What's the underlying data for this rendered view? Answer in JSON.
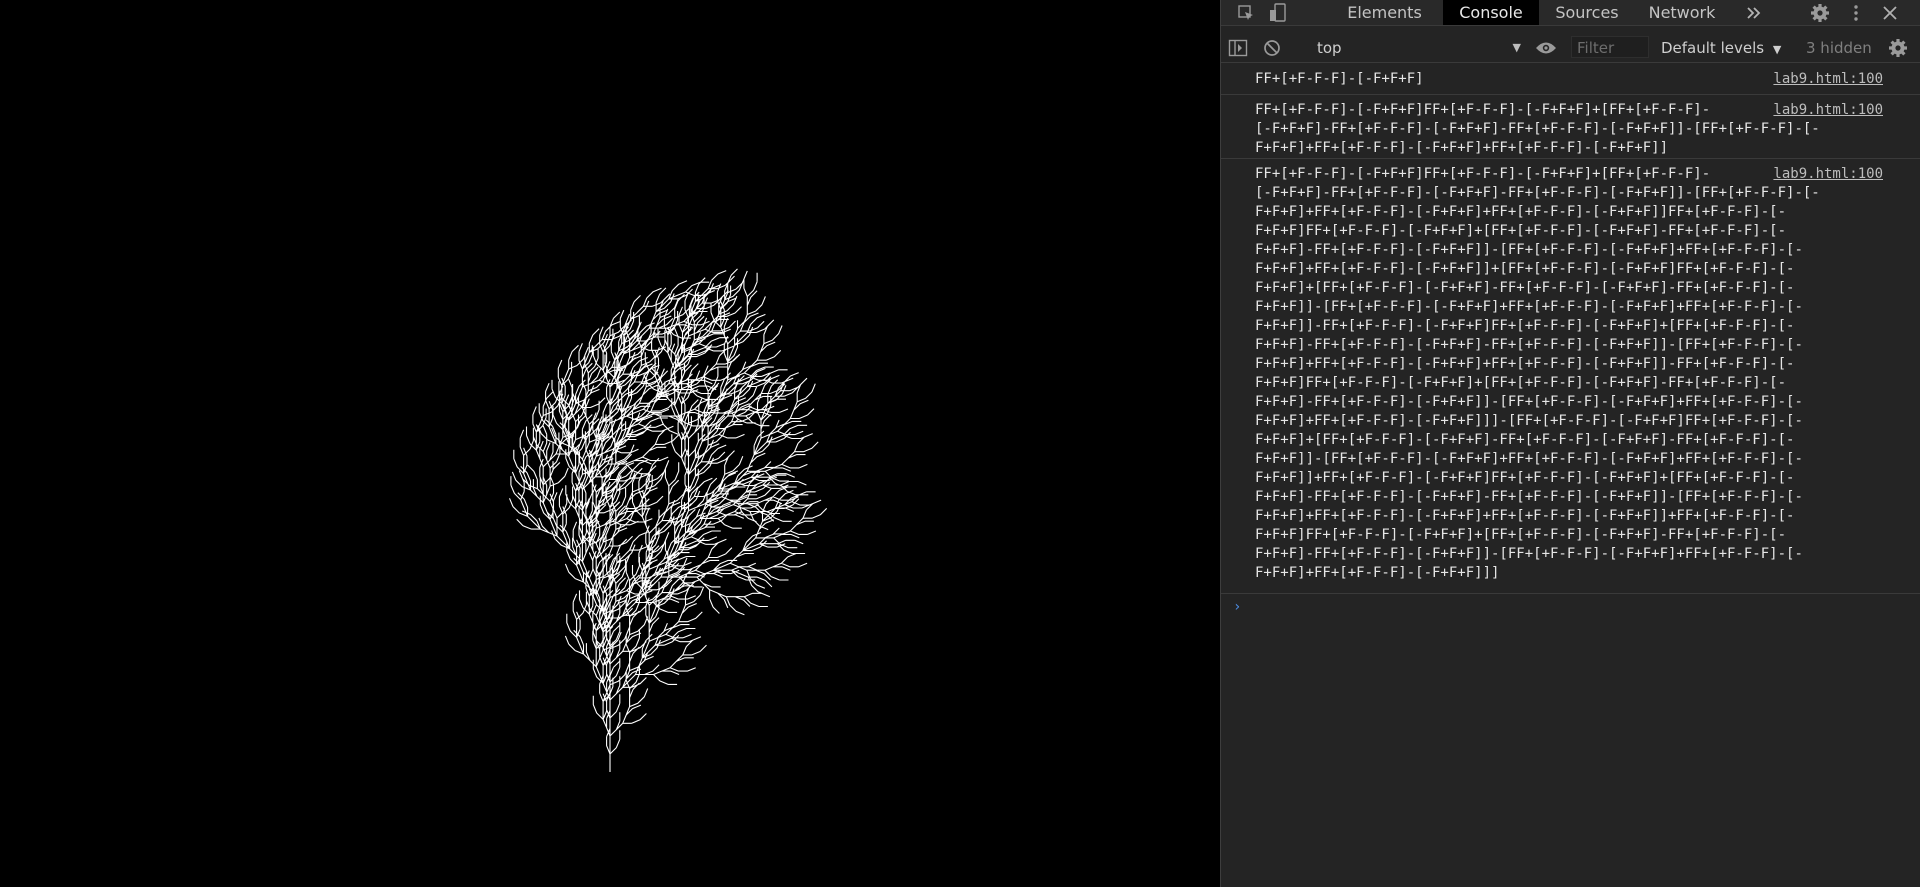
{
  "devtools": {
    "tabs": [
      {
        "label": "Elements"
      },
      {
        "label": "Console"
      },
      {
        "label": "Sources"
      },
      {
        "label": "Network"
      }
    ],
    "more_tabs_icon": "double-chevron-right-icon",
    "icons": {
      "inspect": "inspect-element-icon",
      "device": "device-toggle-icon",
      "settings": "gear-icon",
      "menu": "kebab-menu-icon",
      "close": "close-icon"
    }
  },
  "console": {
    "context": "top",
    "filter_placeholder": "Filter",
    "levels_label": "Default levels",
    "hidden_count": "3 hidden",
    "messages": [
      {
        "source": "lab9.html:100",
        "lines": [
          "FF+[+F-F-F]-[-F+F+F]"
        ]
      },
      {
        "source": "lab9.html:100",
        "lines": [
          "FF+[+F-F-F]-[-F+F+F]FF+[+F-F-F]-[-F+F+F]+[FF+[+F-F-F]-",
          "[-F+F+F]-FF+[+F-F-F]-[-F+F+F]-FF+[+F-F-F]-[-F+F+F]]-[FF+[+F-F-F]-[-",
          "F+F+F]+FF+[+F-F-F]-[-F+F+F]+FF+[+F-F-F]-[-F+F+F]]"
        ]
      },
      {
        "source": "lab9.html:100",
        "lines": [
          "FF+[+F-F-F]-[-F+F+F]FF+[+F-F-F]-[-F+F+F]+[FF+[+F-F-F]-",
          "[-F+F+F]-FF+[+F-F-F]-[-F+F+F]-FF+[+F-F-F]-[-F+F+F]]-[FF+[+F-F-F]-[-",
          "F+F+F]+FF+[+F-F-F]-[-F+F+F]+FF+[+F-F-F]-[-F+F+F]]FF+[+F-F-F]-[-",
          "F+F+F]FF+[+F-F-F]-[-F+F+F]+[FF+[+F-F-F]-[-F+F+F]-FF+[+F-F-F]-[-",
          "F+F+F]-FF+[+F-F-F]-[-F+F+F]]-[FF+[+F-F-F]-[-F+F+F]+FF+[+F-F-F]-[-",
          "F+F+F]+FF+[+F-F-F]-[-F+F+F]]+[FF+[+F-F-F]-[-F+F+F]FF+[+F-F-F]-[-",
          "F+F+F]+[FF+[+F-F-F]-[-F+F+F]-FF+[+F-F-F]-[-F+F+F]-FF+[+F-F-F]-[-",
          "F+F+F]]-[FF+[+F-F-F]-[-F+F+F]+FF+[+F-F-F]-[-F+F+F]+FF+[+F-F-F]-[-",
          "F+F+F]]-FF+[+F-F-F]-[-F+F+F]FF+[+F-F-F]-[-F+F+F]+[FF+[+F-F-F]-[-",
          "F+F+F]-FF+[+F-F-F]-[-F+F+F]-FF+[+F-F-F]-[-F+F+F]]-[FF+[+F-F-F]-[-",
          "F+F+F]+FF+[+F-F-F]-[-F+F+F]+FF+[+F-F-F]-[-F+F+F]]-FF+[+F-F-F]-[-",
          "F+F+F]FF+[+F-F-F]-[-F+F+F]+[FF+[+F-F-F]-[-F+F+F]-FF+[+F-F-F]-[-",
          "F+F+F]-FF+[+F-F-F]-[-F+F+F]]-[FF+[+F-F-F]-[-F+F+F]+FF+[+F-F-F]-[-",
          "F+F+F]+FF+[+F-F-F]-[-F+F+F]]]-[FF+[+F-F-F]-[-F+F+F]FF+[+F-F-F]-[-",
          "F+F+F]+[FF+[+F-F-F]-[-F+F+F]-FF+[+F-F-F]-[-F+F+F]-FF+[+F-F-F]-[-",
          "F+F+F]]-[FF+[+F-F-F]-[-F+F+F]+FF+[+F-F-F]-[-F+F+F]+FF+[+F-F-F]-[-",
          "F+F+F]]+FF+[+F-F-F]-[-F+F+F]FF+[+F-F-F]-[-F+F+F]+[FF+[+F-F-F]-[-",
          "F+F+F]-FF+[+F-F-F]-[-F+F+F]-FF+[+F-F-F]-[-F+F+F]]-[FF+[+F-F-F]-[-",
          "F+F+F]+FF+[+F-F-F]-[-F+F+F]+FF+[+F-F-F]-[-F+F+F]]+FF+[+F-F-F]-[-",
          "F+F+F]FF+[+F-F-F]-[-F+F+F]+[FF+[+F-F-F]-[-F+F+F]-FF+[+F-F-F]-[-",
          "F+F+F]-FF+[+F-F-F]-[-F+F+F]]-[FF+[+F-F-F]-[-F+F+F]+FF+[+F-F-F]-[-",
          "F+F+F]+FF+[+F-F-F]-[-F+F+F]]]"
        ]
      }
    ],
    "prompt_symbol": "›"
  },
  "canvas": {
    "stroke_color": "#ffffff",
    "background": "#000000"
  }
}
